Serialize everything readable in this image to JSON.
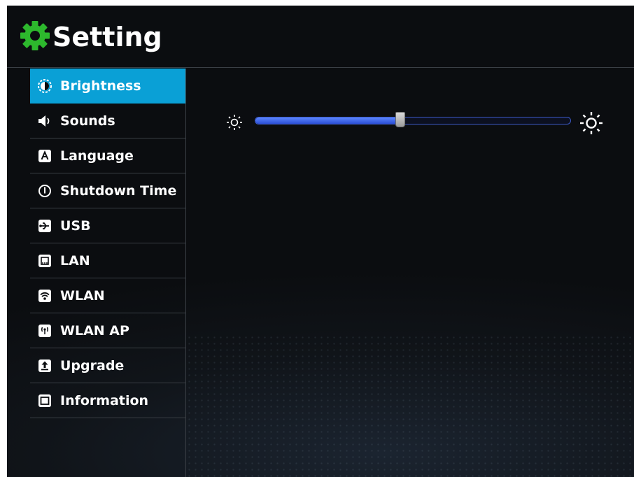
{
  "header": {
    "title": "Setting",
    "icon": "gear-icon",
    "icon_color": "#2db82d"
  },
  "sidebar": {
    "active_index": 0,
    "accent_color": "#0aa0d6",
    "items": [
      {
        "label": "Brightness",
        "icon": "brightness-icon"
      },
      {
        "label": "Sounds",
        "icon": "speaker-icon"
      },
      {
        "label": "Language",
        "icon": "language-icon"
      },
      {
        "label": "Shutdown Time",
        "icon": "power-icon"
      },
      {
        "label": "USB",
        "icon": "usb-icon"
      },
      {
        "label": "LAN",
        "icon": "lan-icon"
      },
      {
        "label": "WLAN",
        "icon": "wifi-icon"
      },
      {
        "label": "WLAN AP",
        "icon": "access-point-icon"
      },
      {
        "label": "Upgrade",
        "icon": "upgrade-icon"
      },
      {
        "label": "Information",
        "icon": "information-icon"
      }
    ]
  },
  "brightness": {
    "level_percent": 46,
    "track_color": "#3b59c6"
  }
}
